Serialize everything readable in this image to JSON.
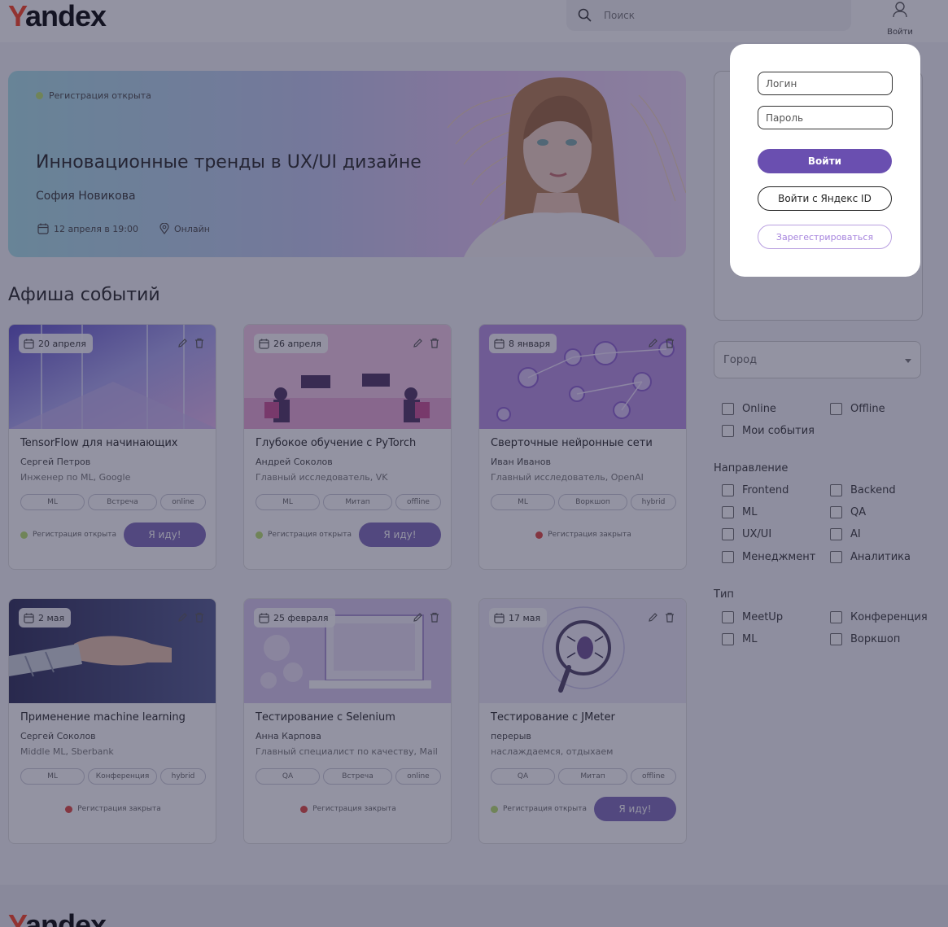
{
  "header": {
    "logo_first": "Y",
    "logo_rest": "andex",
    "search_placeholder": "Поиск",
    "login_label": "Войти"
  },
  "hero": {
    "status": "Регистрация открыта",
    "title": "Инновационные тренды в UX/UI дизайне",
    "speaker": "София Новикова",
    "date": "12 апреля в 19:00",
    "location": "Онлайн"
  },
  "section_title": "Афиша событий",
  "cards": [
    {
      "date": "20 апреля",
      "title": "TensorFlow для начинающих",
      "speaker": "Сергей Петров",
      "role": "Инженер по ML, Google",
      "tags": [
        "ML",
        "Встреча",
        "online"
      ],
      "status": "Регистрация открыта",
      "open": true,
      "button": "Я иду!"
    },
    {
      "date": "26 апреля",
      "title": "Глубокое обучение с PyTorch",
      "speaker": "Андрей Соколов",
      "role": "Главный исследователь, VK",
      "tags": [
        "ML",
        "Митап",
        "offline"
      ],
      "status": "Регистрация открыта",
      "open": true,
      "button": "Я иду!"
    },
    {
      "date": "8 января",
      "title": "Сверточные нейронные сети",
      "speaker": "Иван Иванов",
      "role": "Главный исследователь, OpenAI",
      "tags": [
        "ML",
        "Воркшоп",
        "hybrid"
      ],
      "status": "Регистрация закрыта",
      "open": false,
      "button": ""
    },
    {
      "date": "2 мая",
      "title": "Применение machine learning",
      "speaker": "Сергей Соколов",
      "role": "Middle ML, Sberbank",
      "tags": [
        "ML",
        "Конференция",
        "hybrid"
      ],
      "status": "Регистрация закрыта",
      "open": false,
      "button": ""
    },
    {
      "date": "25 февраля",
      "title": "Тестирование с Selenium",
      "speaker": "Анна Карпова",
      "role": "Главный специалист по качеству, Mail",
      "tags": [
        "QA",
        "Встреча",
        "online"
      ],
      "status": "Регистрация закрыта",
      "open": false,
      "button": ""
    },
    {
      "date": "17 мая",
      "title": "Тестирование с JMeter",
      "speaker": "перерыв",
      "role": "наслаждаемся, отдыхаем",
      "tags": [
        "QA",
        "Митап",
        "offline"
      ],
      "status": "Регистрация открыта",
      "open": true,
      "button": "Я иду!"
    }
  ],
  "sidebar": {
    "city_placeholder": "Город",
    "format": [
      "Online",
      "Offline",
      "Мои события"
    ],
    "direction_label": "Направление",
    "direction": [
      "Frontend",
      "Backend",
      "ML",
      "QA",
      "UX/UI",
      "AI",
      "Менеджмент",
      "Аналитика"
    ],
    "type_label": "Тип",
    "type": [
      "MeetUp",
      "Конференция",
      "ML",
      "Воркшоп"
    ]
  },
  "footer": {
    "logo_first": "Y",
    "logo_rest": "andex"
  },
  "login_modal": {
    "login_placeholder": "Логин",
    "password_placeholder": "Пароль",
    "submit": "Войти",
    "yandex_id": "Войти с Яндекс ID",
    "register": "Зарегестрироваться"
  },
  "colors": {
    "accent": "#6a4fb0",
    "brand_red": "#fc3f1d",
    "status_open": "#b8e06a",
    "status_closed": "#e0453c"
  }
}
